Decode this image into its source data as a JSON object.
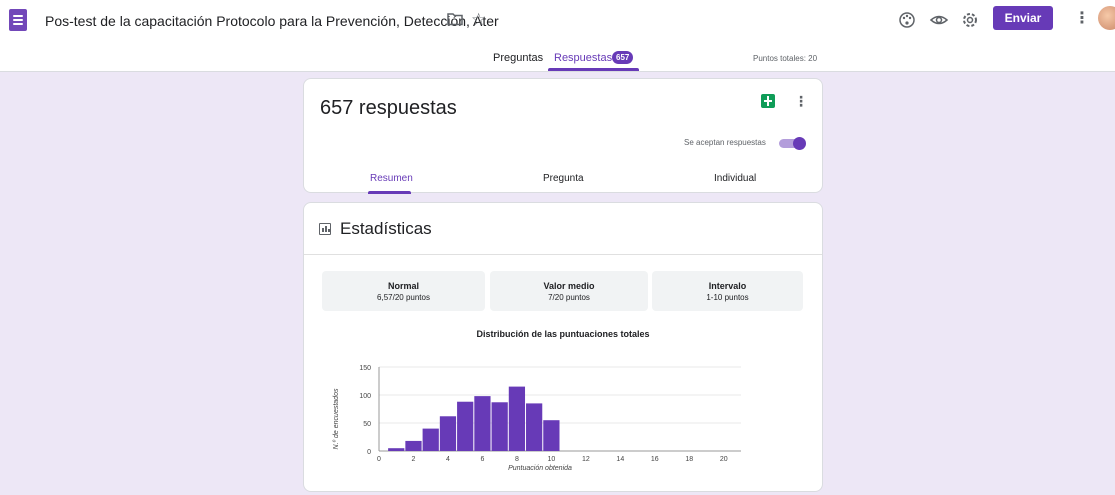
{
  "header": {
    "title": "Pos-test de la capacitación Protocolo para la Prevención, Detección, Ater",
    "send_label": "Enviar"
  },
  "tabs": {
    "questions_label": "Preguntas",
    "responses_label": "Respuestas",
    "responses_badge": "657",
    "total_points": "Puntos totales: 20"
  },
  "summary": {
    "count_label": "657 respuestas",
    "accepting_label": "Se aceptan respuestas",
    "accepting_on": true,
    "subtabs": [
      "Resumen",
      "Pregunta",
      "Individual"
    ],
    "active_subtab": "Resumen"
  },
  "stats": {
    "title": "Estadísticas",
    "boxes": [
      {
        "label": "Normal",
        "value": "6,57/20 puntos"
      },
      {
        "label": "Valor medio",
        "value": "7/20 puntos"
      },
      {
        "label": "Intervalo",
        "value": "1-10 puntos"
      }
    ]
  },
  "colors": {
    "accent": "#673ab7",
    "background": "#ede7f6",
    "bar": "#673ab7",
    "sheets": "#0f9d58"
  },
  "icons": [
    "forms-logo-icon",
    "folder-icon",
    "star-icon",
    "palette-icon",
    "eye-icon",
    "gear-icon",
    "more-vert-icon",
    "sheets-icon",
    "bar-chart-icon"
  ],
  "chart_data": {
    "type": "bar",
    "title": "Distribución de las puntuaciones totales",
    "xlabel": "Puntuación obtenida",
    "ylabel": "N.º de encuestados",
    "x": [
      1,
      2,
      3,
      4,
      5,
      6,
      7,
      8,
      9,
      10
    ],
    "values": [
      5,
      18,
      40,
      62,
      88,
      98,
      87,
      115,
      85,
      55
    ],
    "xlim": [
      0,
      21
    ],
    "ylim": [
      0,
      150
    ],
    "xticks": [
      0,
      2,
      4,
      6,
      8,
      10,
      12,
      14,
      16,
      18,
      20
    ],
    "yticks": [
      0,
      50,
      100,
      150
    ],
    "grid": true
  }
}
